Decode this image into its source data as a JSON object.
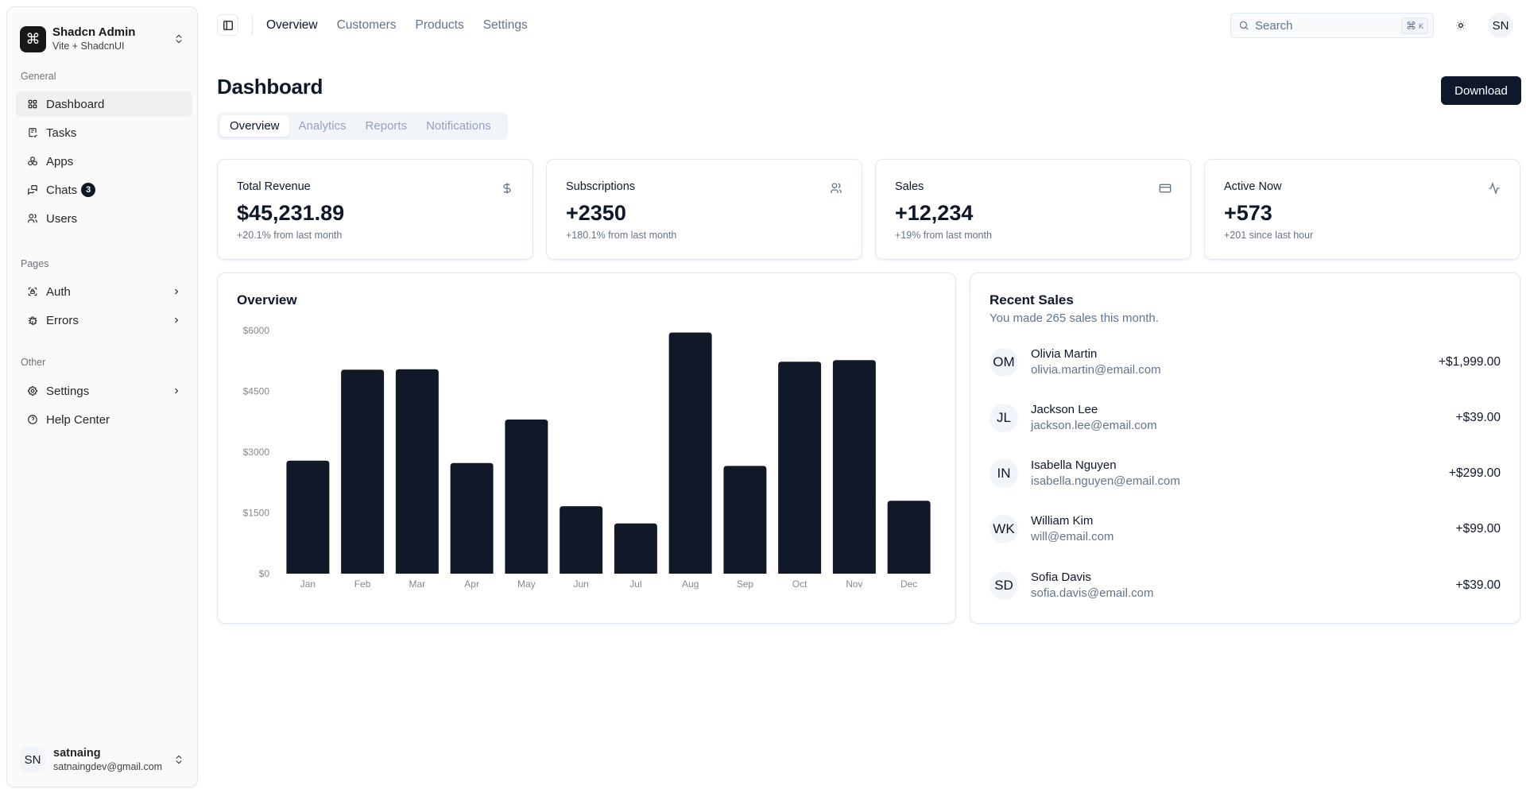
{
  "sidebar": {
    "brand": {
      "title": "Shadcn Admin",
      "subtitle": "Vite + ShadcnUI",
      "logo_icon": "command-icon"
    },
    "groups": [
      {
        "label": "General",
        "items": [
          {
            "label": "Dashboard",
            "icon": "layout-dashboard-icon",
            "active": true
          },
          {
            "label": "Tasks",
            "icon": "checklist-icon"
          },
          {
            "label": "Apps",
            "icon": "packages-icon"
          },
          {
            "label": "Chats",
            "icon": "messages-icon",
            "badge": "3"
          },
          {
            "label": "Users",
            "icon": "users-icon"
          }
        ]
      },
      {
        "label": "Pages",
        "items": [
          {
            "label": "Auth",
            "icon": "lock-access-icon",
            "has_submenu": true
          },
          {
            "label": "Errors",
            "icon": "bug-icon",
            "has_submenu": true
          }
        ]
      },
      {
        "label": "Other",
        "items": [
          {
            "label": "Settings",
            "icon": "settings-icon",
            "has_submenu": true
          },
          {
            "label": "Help Center",
            "icon": "help-circle-icon"
          }
        ]
      }
    ],
    "user": {
      "initials": "SN",
      "name": "satnaing",
      "email": "satnaingdev@gmail.com"
    }
  },
  "header": {
    "nav": [
      {
        "label": "Overview",
        "active": true
      },
      {
        "label": "Customers"
      },
      {
        "label": "Products"
      },
      {
        "label": "Settings"
      }
    ],
    "search": {
      "placeholder": "Search",
      "shortcut_symbol": "⌘",
      "shortcut_key": "K"
    },
    "avatar_initials": "SN"
  },
  "page": {
    "title": "Dashboard",
    "download_label": "Download",
    "tabs": [
      {
        "label": "Overview",
        "active": true
      },
      {
        "label": "Analytics"
      },
      {
        "label": "Reports"
      },
      {
        "label": "Notifications"
      }
    ]
  },
  "stats": [
    {
      "title": "Total Revenue",
      "value": "$45,231.89",
      "sub": "+20.1% from last month",
      "icon": "dollar-icon"
    },
    {
      "title": "Subscriptions",
      "value": "+2350",
      "sub": "+180.1% from last month",
      "icon": "users-icon"
    },
    {
      "title": "Sales",
      "value": "+12,234",
      "sub": "+19% from last month",
      "icon": "credit-card-icon"
    },
    {
      "title": "Active Now",
      "value": "+573",
      "sub": "+201 since last hour",
      "icon": "activity-icon"
    }
  ],
  "overview": {
    "title": "Overview"
  },
  "chart_data": {
    "type": "bar",
    "title": "Overview",
    "categories": [
      "Jan",
      "Feb",
      "Mar",
      "Apr",
      "May",
      "Jun",
      "Jul",
      "Aug",
      "Sep",
      "Oct",
      "Nov",
      "Dec"
    ],
    "values": [
      2790,
      5035,
      5045,
      2730,
      3805,
      1665,
      1240,
      5950,
      2660,
      5230,
      5270,
      1800
    ],
    "yticks": [
      0,
      1500,
      3000,
      4500,
      6000
    ],
    "ytick_labels": [
      "$0",
      "$1500",
      "$3000",
      "$4500",
      "$6000"
    ],
    "ylim": [
      0,
      6000
    ],
    "xlabel": "",
    "ylabel": "",
    "grid": false,
    "legend": "none",
    "bar_color": "#111827"
  },
  "recent_sales": {
    "title": "Recent Sales",
    "subtitle": "You made 265 sales this month.",
    "items": [
      {
        "initials": "OM",
        "name": "Olivia Martin",
        "email": "olivia.martin@email.com",
        "amount": "+$1,999.00"
      },
      {
        "initials": "JL",
        "name": "Jackson Lee",
        "email": "jackson.lee@email.com",
        "amount": "+$39.00"
      },
      {
        "initials": "IN",
        "name": "Isabella Nguyen",
        "email": "isabella.nguyen@email.com",
        "amount": "+$299.00"
      },
      {
        "initials": "WK",
        "name": "William Kim",
        "email": "will@email.com",
        "amount": "+$99.00"
      },
      {
        "initials": "SD",
        "name": "Sofia Davis",
        "email": "sofia.davis@email.com",
        "amount": "+$39.00"
      }
    ]
  }
}
